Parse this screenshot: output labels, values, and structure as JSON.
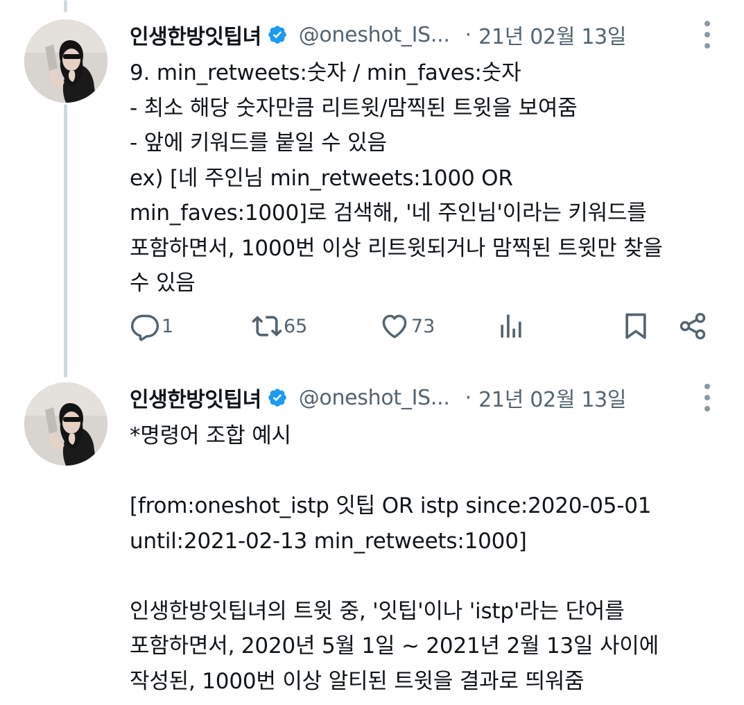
{
  "tweets": [
    {
      "display_name": "인생한방잇팁녀",
      "handle": "@oneshot_IS...",
      "separator": "·",
      "date": "21년 02월 13일",
      "lines": [
        "9. min_retweets:숫자 / min_faves:숫자",
        "- 최소 해당 숫자만큼 리트윗/맘찍된 트윗을 보여줌",
        "- 앞에 키워드를 붙일 수 있음",
        "ex) [네 주인님 min_retweets:1000 OR",
        "min_faves:1000]로 검색해, '네 주인님'이라는 키워드를",
        "포함하면서, 1000번 이상 리트윗되거나 맘찍된 트윗만 찾을",
        "수 있음"
      ],
      "actions": {
        "reply_count": "1",
        "retweet_count": "65",
        "like_count": "73"
      }
    },
    {
      "display_name": "인생한방잇팁녀",
      "handle": "@oneshot_IS...",
      "separator": "·",
      "date": "21년 02월 13일",
      "lines": [
        "*명령어 조합 예시",
        "",
        "[from:oneshot_istp 잇팁 OR istp since:2020-05-01",
        "until:2021-02-13 min_retweets:1000]",
        "",
        "인생한방잇팁녀의 트윗 중, '잇팁'이나 'istp'라는 단어를",
        "포함하면서, 2020년 5월 1일 ~ 2021년 2월 13일 사이에",
        "작성된, 1000번 이상 알티된 트윗을 결과로 띄워줌"
      ]
    }
  ],
  "icons": {
    "verified": "verified-badge-icon",
    "more": "more-options-icon",
    "reply": "reply-icon",
    "retweet": "retweet-icon",
    "like": "like-icon",
    "views": "views-icon",
    "bookmark": "bookmark-icon",
    "share": "share-icon"
  },
  "colors": {
    "text": "#0f1419",
    "secondary": "#536471",
    "verified": "#1d9bf0",
    "thread_line": "#cfd9de"
  }
}
